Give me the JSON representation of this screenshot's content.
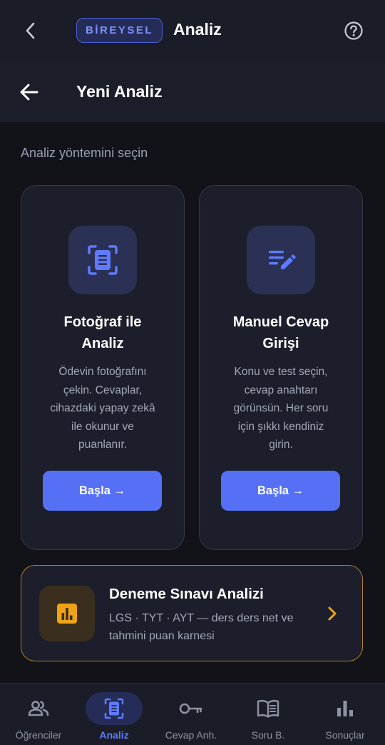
{
  "header": {
    "badge": "BİREYSEL",
    "title": "Analiz",
    "back_icon": "chevron-left-icon",
    "help_icon": "help-circle-icon"
  },
  "subheader": {
    "title": "Yeni Analiz",
    "back_icon": "arrow-left-icon"
  },
  "section_label": "Analiz yöntemini seçin",
  "methods": [
    {
      "icon": "document-scan-icon",
      "title_line1": "Fotoğraf ile",
      "title_line2": "Analiz",
      "desc_lines": [
        "Ödevin fotoğrafını",
        "çekin. Cevaplar,",
        "cihazdaki yapay zekâ",
        "ile okunur ve",
        "puanlanır."
      ],
      "button": "Başla →"
    },
    {
      "icon": "edit-note-icon",
      "title_line1": "Manuel Cevap",
      "title_line2": "Girişi",
      "desc_lines": [
        "Konu ve test seçin,",
        "cevap anahtarı",
        "görünsün. Her soru",
        "için şıkkı kendiniz",
        "girin."
      ],
      "button": "Başla →"
    }
  ],
  "exam": {
    "icon": "bar-chart-icon",
    "title": "Deneme Sınavı Analizi",
    "desc_line1": "LGS · TYT · AYT — ders ders net ve",
    "desc_line2": "tahmini puan karnesi",
    "chevron": "chevron-right-icon"
  },
  "nav": [
    {
      "label": "Öğrenciler",
      "icon": "users-icon",
      "active": false
    },
    {
      "label": "Analiz",
      "icon": "document-scan-icon",
      "active": true
    },
    {
      "label": "Cevap Anh.",
      "icon": "key-icon",
      "active": false
    },
    {
      "label": "Soru B.",
      "icon": "book-icon",
      "active": false
    },
    {
      "label": "Sonuçlar",
      "icon": "bar-chart-icon",
      "active": false
    }
  ],
  "colors": {
    "accent": "#5570f5",
    "active_nav": "#5f7bff",
    "exam_border": "#b07d25",
    "exam_icon": "#f0a316",
    "background": "#111319"
  }
}
